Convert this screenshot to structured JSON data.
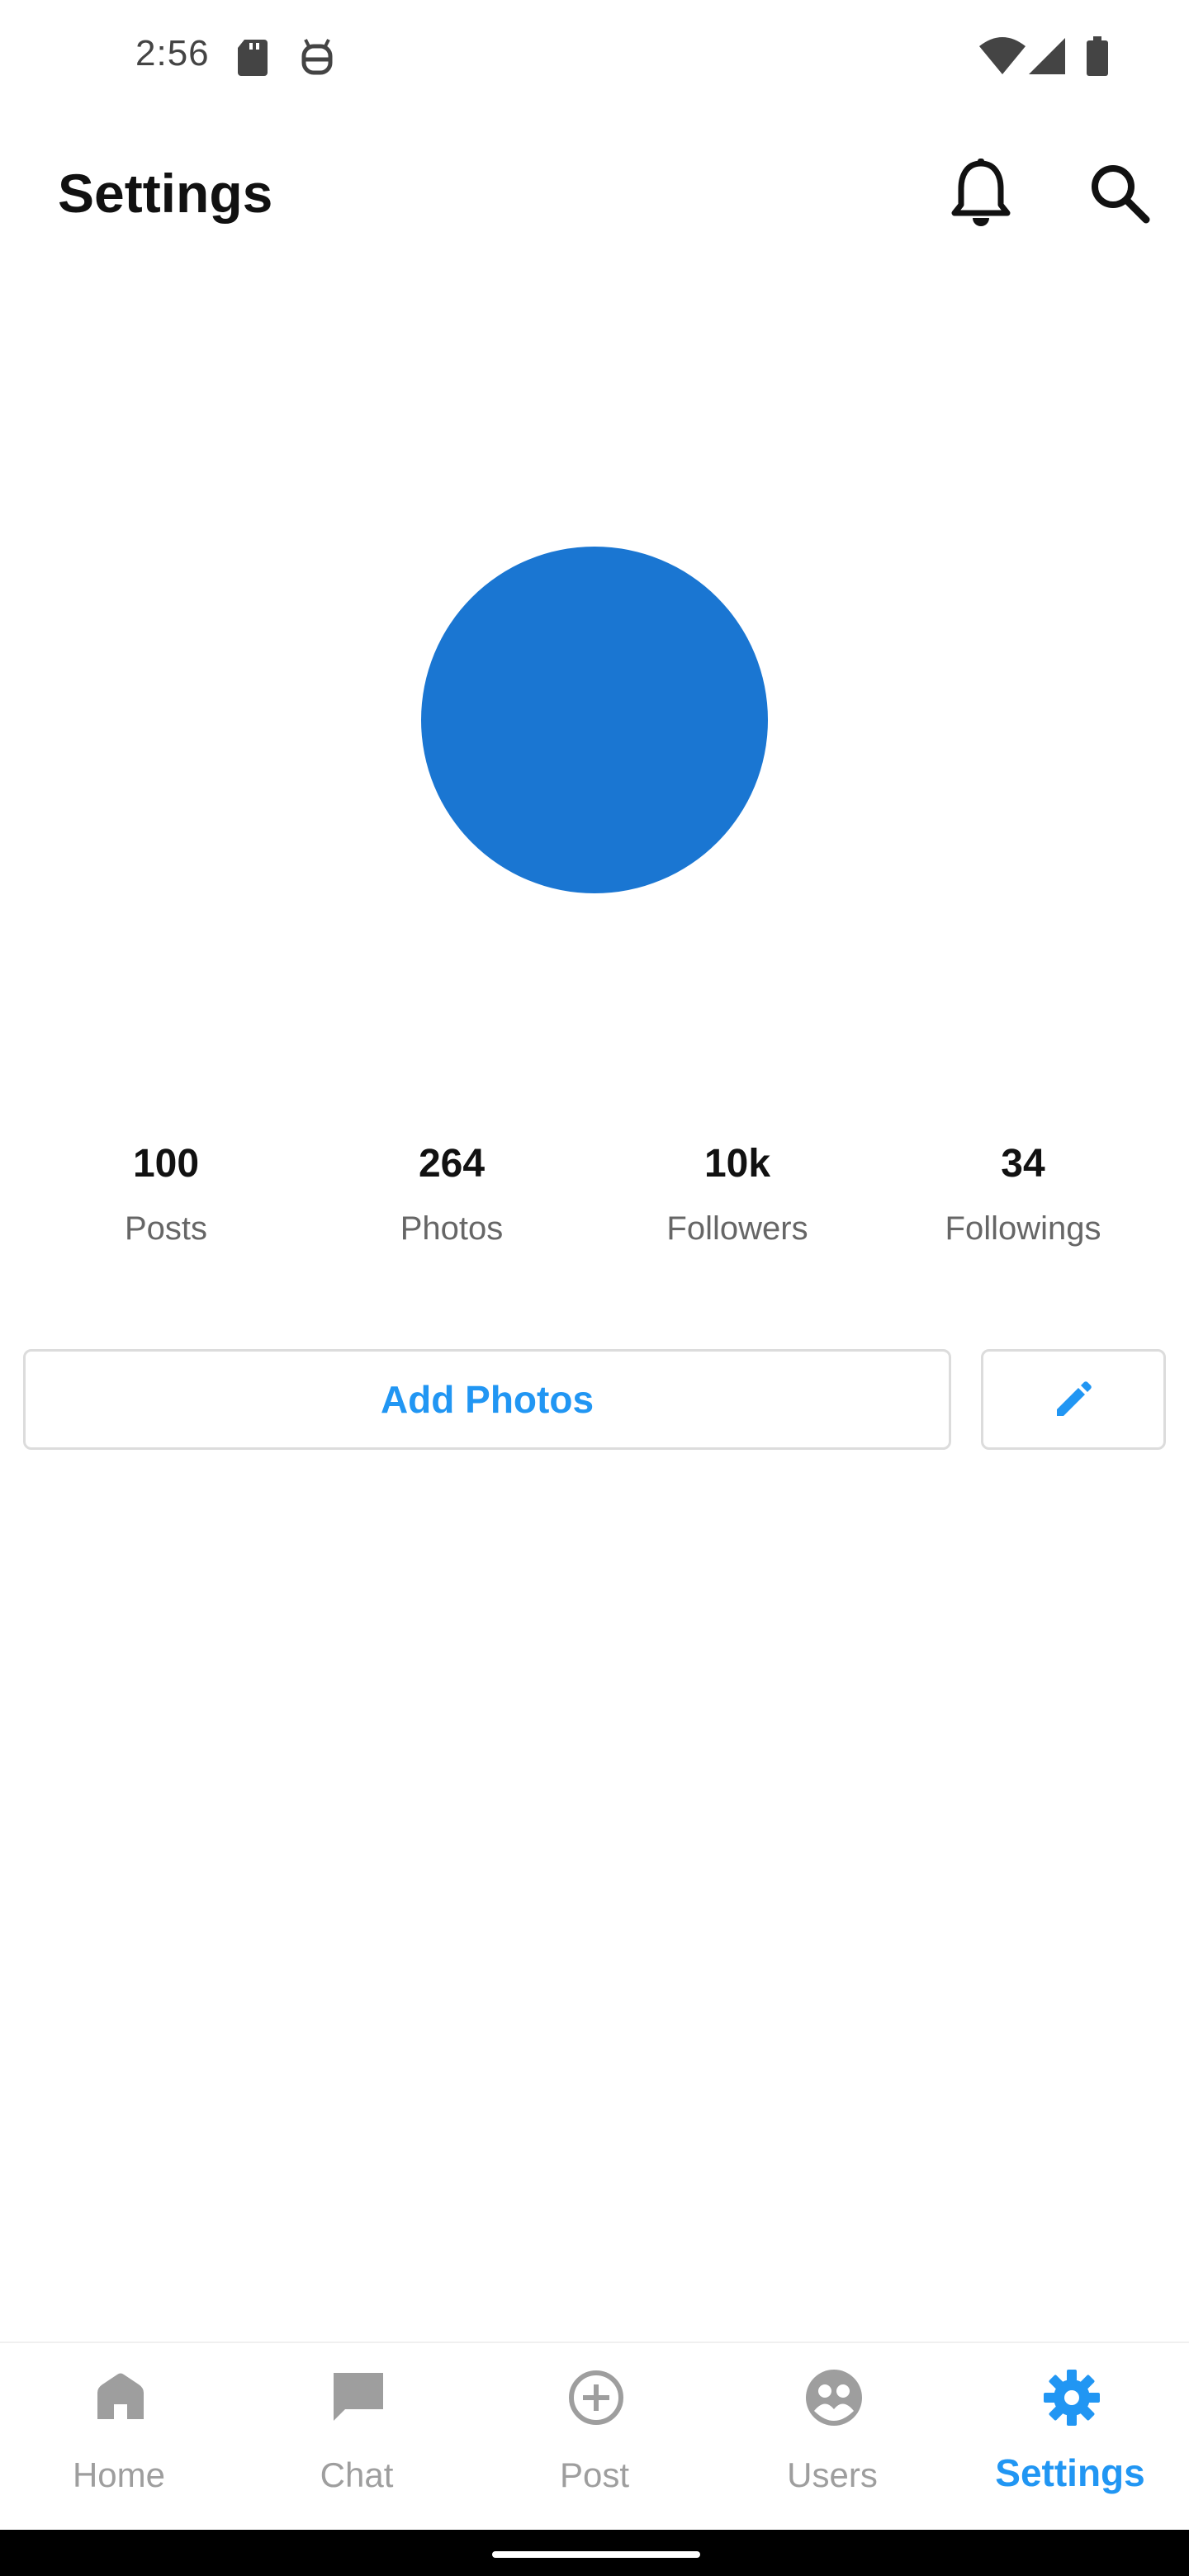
{
  "status_bar": {
    "time": "2:56",
    "icons": [
      "sd-card-icon",
      "android-icon",
      "wifi-icon",
      "signal-icon",
      "battery-icon"
    ]
  },
  "app_bar": {
    "title": "Settings",
    "actions": [
      "bell-icon",
      "search-icon"
    ]
  },
  "profile": {
    "avatar_color": "#1a76d2"
  },
  "stats": [
    {
      "value": "100",
      "label": "Posts"
    },
    {
      "value": "264",
      "label": "Photos"
    },
    {
      "value": "10k",
      "label": "Followers"
    },
    {
      "value": "34",
      "label": "Followings"
    }
  ],
  "actions": {
    "add_photos_label": "Add Photos",
    "edit_icon": "pencil-icon"
  },
  "bottom_nav": {
    "active": "Settings",
    "items": [
      {
        "label": "Home",
        "icon": "home-icon"
      },
      {
        "label": "Chat",
        "icon": "chat-icon"
      },
      {
        "label": "Post",
        "icon": "add-circle-icon"
      },
      {
        "label": "Users",
        "icon": "users-icon"
      },
      {
        "label": "Settings",
        "icon": "gear-icon"
      }
    ]
  },
  "colors": {
    "accent": "#2196f3",
    "inactive": "#9e9e9e",
    "avatar": "#1a76d2"
  }
}
